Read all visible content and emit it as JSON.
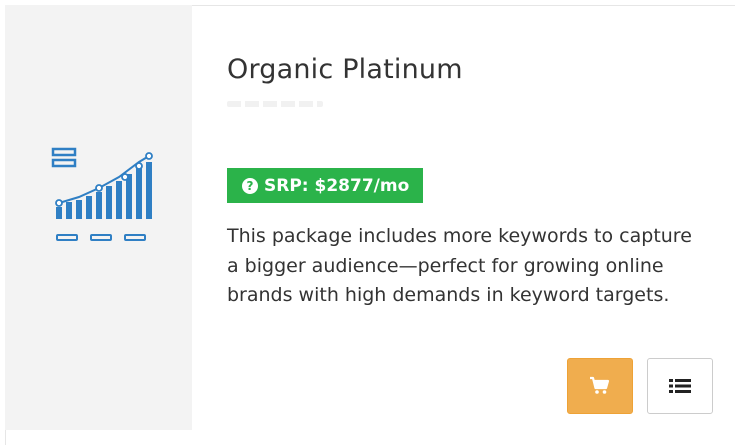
{
  "product": {
    "title": "Organic Platinum",
    "price_badge": "SRP: $2877/mo",
    "description": "This package includes more keywords to capture a bigger audience—perfect for growing online brands with high demands in keyword targets."
  },
  "icons": {
    "chart": "growth-chart-icon",
    "help": "question-circle-icon",
    "cart": "cart-icon",
    "list": "list-icon"
  },
  "colors": {
    "badge": "#2bb34a",
    "cart_button": "#f0ad4e",
    "icon": "#2f7fc4",
    "left_panel": "#f3f3f3"
  }
}
